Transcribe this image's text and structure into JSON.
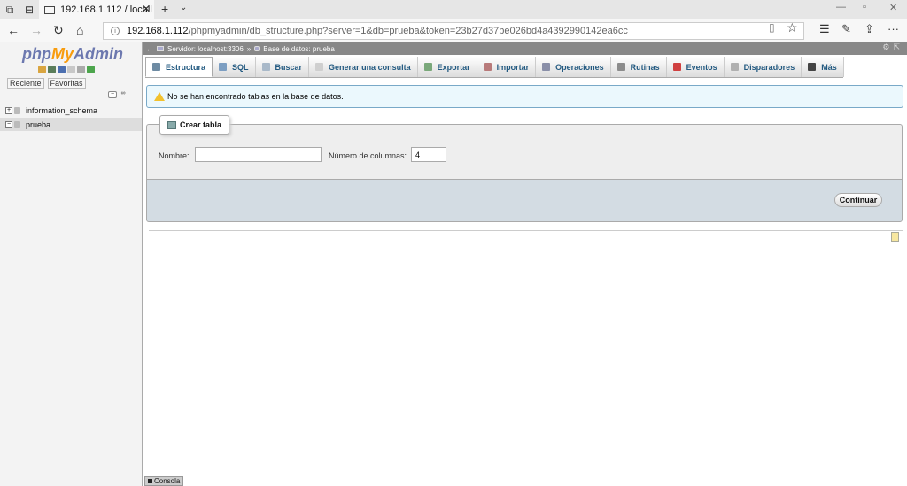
{
  "browser": {
    "tab_title": "192.168.1.112 / locall",
    "url_main": "192.168.1.112",
    "url_rest": "/phpmyadmin/db_structure.php?server=1&db=prueba&token=23b27d37be026bd4a4392990142ea6cc"
  },
  "sidebar": {
    "logo_php": "php",
    "logo_my": "My",
    "logo_admin": "Admin",
    "recent_label": "Reciente",
    "favorites_label": "Favoritas",
    "databases": [
      {
        "name": "information_schema"
      },
      {
        "name": "prueba"
      }
    ]
  },
  "breadcrumb": {
    "server": "Servidor: localhost:3306",
    "separator": "»",
    "database": "Base de datos: prueba"
  },
  "menu": {
    "tabs": [
      {
        "label": "Estructura",
        "icon": "structure-icon",
        "color": "#6e8ba3"
      },
      {
        "label": "SQL",
        "icon": "sql-icon",
        "color": "#7c9ec2"
      },
      {
        "label": "Buscar",
        "icon": "search-icon",
        "color": "#a9b9c9"
      },
      {
        "label": "Generar una consulta",
        "icon": "query-icon",
        "color": "#cfcfcf"
      },
      {
        "label": "Exportar",
        "icon": "export-icon",
        "color": "#7aa87a"
      },
      {
        "label": "Importar",
        "icon": "import-icon",
        "color": "#b87a7a"
      },
      {
        "label": "Operaciones",
        "icon": "wrench-icon",
        "color": "#8a8fa8"
      },
      {
        "label": "Rutinas",
        "icon": "routines-icon",
        "color": "#8c8c8c"
      },
      {
        "label": "Eventos",
        "icon": "clock-icon",
        "color": "#d04040"
      },
      {
        "label": "Disparadores",
        "icon": "triggers-icon",
        "color": "#b0b0b0"
      },
      {
        "label": "Más",
        "icon": "more-icon",
        "color": "#444"
      }
    ]
  },
  "notice": {
    "text": "No se han encontrado tablas en la base de datos."
  },
  "create_table": {
    "legend": "Crear tabla",
    "name_label": "Nombre:",
    "name_value": "",
    "columns_label": "Número de columnas:",
    "columns_value": "4",
    "submit_label": "Continuar"
  },
  "console": {
    "label": "Consola"
  }
}
